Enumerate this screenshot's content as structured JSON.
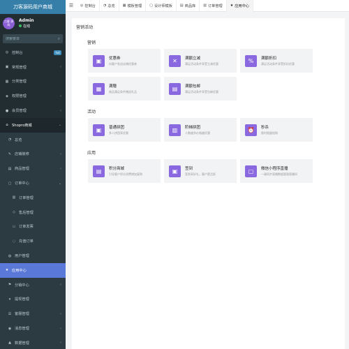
{
  "app": {
    "brand": "刀客源码用户商城"
  },
  "user": {
    "avatar_text": "刀客 源码",
    "name": "Admin",
    "status": "在线"
  },
  "search": {
    "placeholder": "搜索菜单"
  },
  "sidebar": {
    "items": [
      {
        "icon": "dashboard-icon",
        "glyph": "◎",
        "label": "控制台",
        "badge": "hot",
        "style": ""
      },
      {
        "icon": "routine-icon",
        "glyph": "▣",
        "label": "常规管理",
        "arrow": "‹",
        "style": ""
      },
      {
        "icon": "category-icon",
        "glyph": "▦",
        "label": "分类管理",
        "style": ""
      },
      {
        "icon": "permission-icon",
        "glyph": "◈",
        "label": "权限管理",
        "arrow": "‹",
        "style": ""
      },
      {
        "icon": "member-icon",
        "glyph": "●",
        "label": "会员管理",
        "arrow": "‹",
        "style": ""
      },
      {
        "icon": "shopro-icon",
        "glyph": "⌂",
        "label": "Shopro商城",
        "arrow": "⌄",
        "style": "open"
      },
      {
        "icon": "overview-icon",
        "glyph": "◔",
        "label": "总览",
        "style": "sub"
      },
      {
        "icon": "decoration-icon",
        "glyph": "✎",
        "label": "店铺装修",
        "arrow": "‹",
        "style": "sub"
      },
      {
        "icon": "goods-icon",
        "glyph": "▤",
        "label": "商品管理",
        "arrow": "‹",
        "style": "sub"
      },
      {
        "icon": "order-center-icon",
        "glyph": "▢",
        "label": "订单中心",
        "arrow": "⌄",
        "style": "sub"
      },
      {
        "icon": "order-icon",
        "glyph": "▥",
        "label": "订单管理",
        "style": "sub2"
      },
      {
        "icon": "after-sale-icon",
        "glyph": "◇",
        "label": "售后管理",
        "style": "sub2"
      },
      {
        "icon": "order-comment-icon",
        "glyph": "▭",
        "label": "订单发票",
        "style": "sub2"
      },
      {
        "icon": "recharge-icon",
        "glyph": "◌",
        "label": "充值订单",
        "style": "sub2"
      },
      {
        "icon": "users-icon",
        "glyph": "◍",
        "label": "用户管理",
        "style": "sub"
      },
      {
        "icon": "star-icon",
        "glyph": "★",
        "label": "应用中心",
        "style": "active"
      },
      {
        "icon": "distribution-icon",
        "glyph": "⚑",
        "label": "分销中心",
        "arrow": "‹",
        "style": "sub"
      },
      {
        "icon": "withdraw-icon",
        "glyph": "▾",
        "label": "提现管理",
        "style": "sub"
      },
      {
        "icon": "customer-service-icon",
        "glyph": "☰",
        "label": "客服管理",
        "arrow": "‹",
        "style": "sub"
      },
      {
        "icon": "notice-icon",
        "glyph": "◉",
        "label": "消息管理",
        "arrow": "‹",
        "style": "sub"
      },
      {
        "icon": "data-icon",
        "glyph": "▲",
        "label": "数据管理",
        "arrow": "‹",
        "style": "sub"
      }
    ]
  },
  "tabs": [
    {
      "icon": "dashboard-icon",
      "glyph": "◎",
      "label": "控制台"
    },
    {
      "icon": "overview-icon",
      "glyph": "◔",
      "label": "总览"
    },
    {
      "icon": "template-icon",
      "glyph": "▦",
      "label": "模板管理"
    },
    {
      "icon": "design-icon",
      "glyph": "▢",
      "label": "设计师模板"
    },
    {
      "icon": "goods-lib-icon",
      "glyph": "▤",
      "label": "商品库"
    },
    {
      "icon": "order-icon",
      "glyph": "▥",
      "label": "订单管理"
    },
    {
      "icon": "star-icon",
      "glyph": "★",
      "label": "应用中心",
      "active": true
    }
  ],
  "main": {
    "panel_title": "营销活动",
    "sections": [
      {
        "title": "营销",
        "cards": [
          {
            "icon": "coupon-icon",
            "glyph": "▣",
            "name": "优惠券",
            "desc": "向客户发送店铺优惠券"
          },
          {
            "icon": "full-gift-icon",
            "glyph": "✕",
            "name": "满额立减",
            "desc": "满足活动条件享受立减优惠"
          },
          {
            "icon": "discount-icon",
            "glyph": "%",
            "name": "满额折扣",
            "desc": "满足活动条件享受折扣优惠"
          },
          {
            "icon": "full-icon",
            "glyph": "▦",
            "name": "满赠",
            "desc": "商品满足条件赠送礼品"
          },
          {
            "icon": "free-shipping-icon",
            "glyph": "▤",
            "name": "满额包邮",
            "desc": "满足活动条件享受包邮优惠"
          }
        ]
      },
      {
        "title": "活动",
        "cards": [
          {
            "icon": "groupon-icon",
            "glyph": "▣",
            "name": "普通拼团",
            "desc": "多人拼团享优惠"
          },
          {
            "icon": "ladder-groupon-icon",
            "glyph": "▥",
            "name": "阶梯拼团",
            "desc": "人数越多价格越优惠"
          },
          {
            "icon": "seckill-icon",
            "glyph": "⏰",
            "name": "秒杀",
            "desc": "限时限量抢购"
          }
        ]
      },
      {
        "title": "应用",
        "cards": [
          {
            "icon": "score-shop-icon",
            "glyph": "▤",
            "name": "积分商城",
            "desc": "引导客户积分消费增加复购"
          },
          {
            "icon": "signin-icon",
            "glyph": "▣",
            "name": "签到",
            "desc": "签到享好礼，客户更活跃"
          },
          {
            "icon": "live-icon",
            "glyph": "▢",
            "name": "微信小程序直播",
            "desc": "一键同步直播数据管理直播间"
          }
        ]
      }
    ]
  }
}
